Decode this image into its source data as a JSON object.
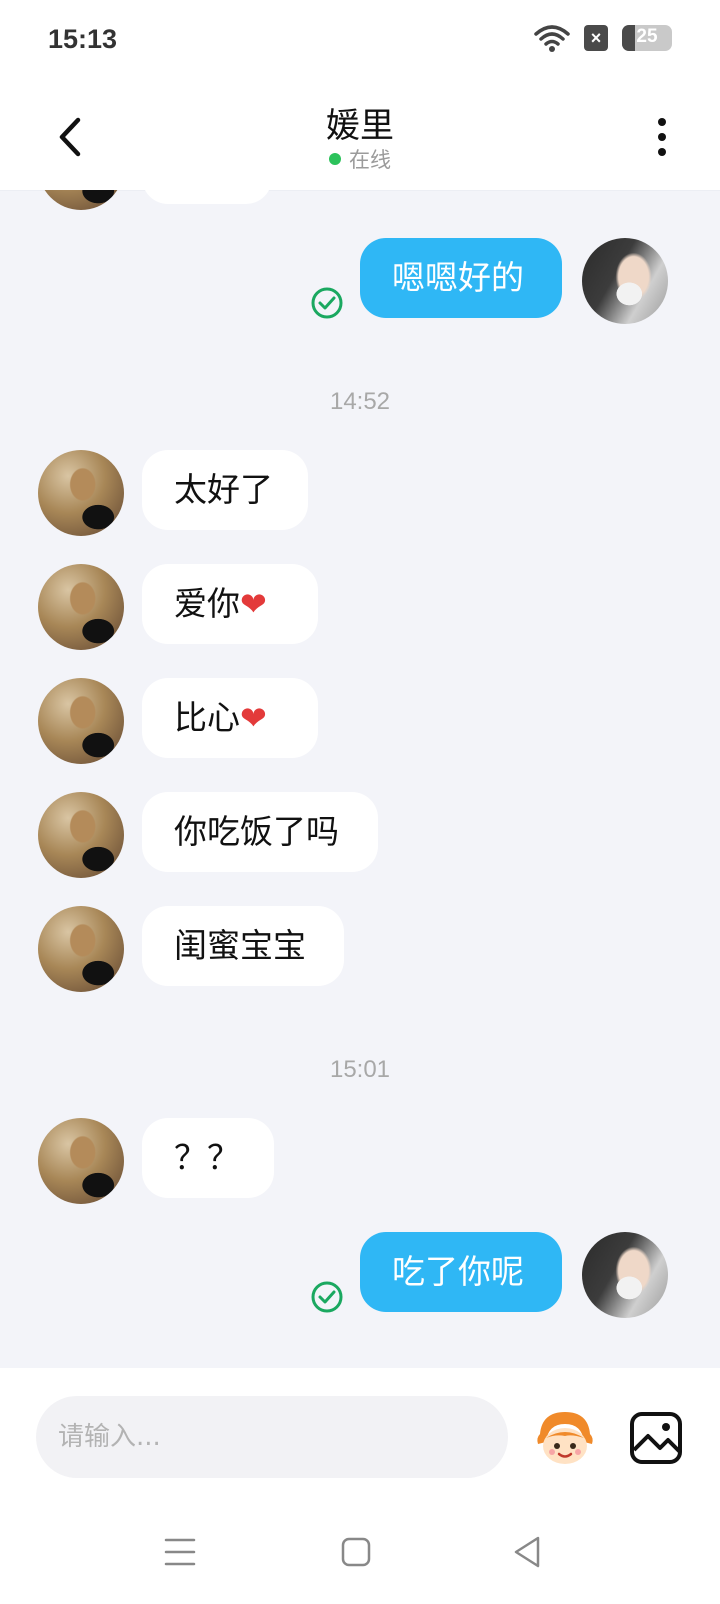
{
  "status_bar": {
    "time": "15:13",
    "battery_level": "25",
    "battery_fraction": 0.25
  },
  "header": {
    "contact_name": "媛里",
    "contact_status": "在线"
  },
  "messages": [
    {
      "side": "out",
      "text": "嗯嗯好的",
      "read": true
    },
    {
      "type": "time",
      "text": "14:52"
    },
    {
      "side": "in",
      "text": "太好了"
    },
    {
      "side": "in",
      "text": "爱你",
      "emoji": "❤"
    },
    {
      "side": "in",
      "text": "比心",
      "emoji": "❤"
    },
    {
      "side": "in",
      "text": "你吃饭了吗"
    },
    {
      "side": "in",
      "text": "闺蜜宝宝"
    },
    {
      "type": "time",
      "text": "15:01"
    },
    {
      "side": "in",
      "text": "？？"
    },
    {
      "side": "out",
      "text": "吃了你呢",
      "read": true
    }
  ],
  "composer": {
    "placeholder": "请输入..."
  },
  "colors": {
    "outgoing_bubble": "#2fb7f5",
    "online": "#2cc25b",
    "read_check": "#1aa860"
  },
  "icons": [
    "back-icon",
    "more-icon",
    "read-check-icon",
    "sticker-icon",
    "image-icon",
    "menu-icon",
    "home-icon",
    "back-triangle-icon"
  ]
}
